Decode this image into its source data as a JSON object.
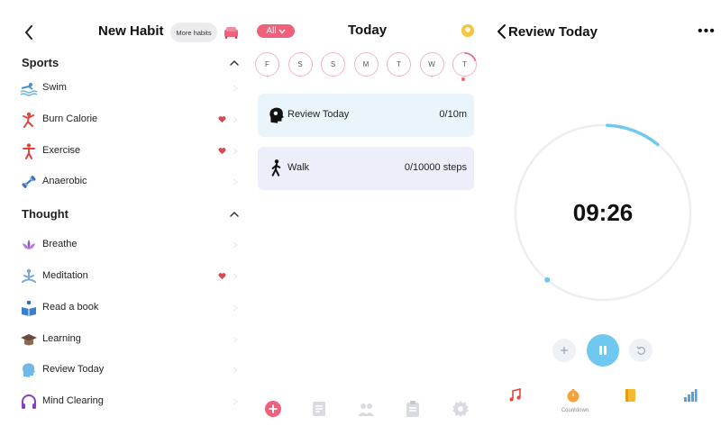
{
  "left_panel": {
    "title": "New Habit",
    "more_habits_label": "More habits",
    "sections": [
      {
        "label": "Sports",
        "items": [
          {
            "label": "Swim",
            "icon": "swim-icon",
            "favorite": false
          },
          {
            "label": "Burn Calorie",
            "icon": "burn-calorie-icon",
            "favorite": true
          },
          {
            "label": "Exercise",
            "icon": "exercise-icon",
            "favorite": true
          },
          {
            "label": "Anaerobic",
            "icon": "dumbbell-icon",
            "favorite": false
          }
        ]
      },
      {
        "label": "Thought",
        "items": [
          {
            "label": "Breathe",
            "icon": "lotus-icon",
            "favorite": false
          },
          {
            "label": "Meditation",
            "icon": "meditation-icon",
            "favorite": true
          },
          {
            "label": "Read a book",
            "icon": "read-book-icon",
            "favorite": false
          },
          {
            "label": "Learning",
            "icon": "graduation-cap-icon",
            "favorite": false
          },
          {
            "label": "Review Today",
            "icon": "head-icon",
            "favorite": false
          },
          {
            "label": "Mind Clearing",
            "icon": "headphones-icon",
            "favorite": false
          }
        ]
      }
    ]
  },
  "middle_panel": {
    "filter_label": "All",
    "title": "Today",
    "days": [
      "F",
      "S",
      "S",
      "M",
      "T",
      "W",
      "T"
    ],
    "today_progress": 0.2,
    "cards": [
      {
        "label": "Review Today",
        "value": "0/10m",
        "icon": "head-icon",
        "color": "#eaf5fb"
      },
      {
        "label": "Walk",
        "value": "0/10000 steps",
        "icon": "walk-icon",
        "color": "#eceff9"
      }
    ],
    "tabs": [
      "add-icon",
      "notes-icon",
      "friends-icon",
      "clipboard-icon",
      "gear-icon"
    ]
  },
  "right_panel": {
    "title": "Review Today",
    "menu_label": "•••",
    "timer": "09:26",
    "progress": 0.1,
    "tools": [
      {
        "icon": "music-icon",
        "label": ""
      },
      {
        "icon": "countdown-icon",
        "label": "Countdown"
      },
      {
        "icon": "notebook-icon",
        "label": ""
      },
      {
        "icon": "stats-icon",
        "label": ""
      }
    ]
  },
  "colors": {
    "accent_pink": "#f0607a",
    "accent_blue": "#6fc8ef",
    "heart_red": "#e0444e"
  }
}
